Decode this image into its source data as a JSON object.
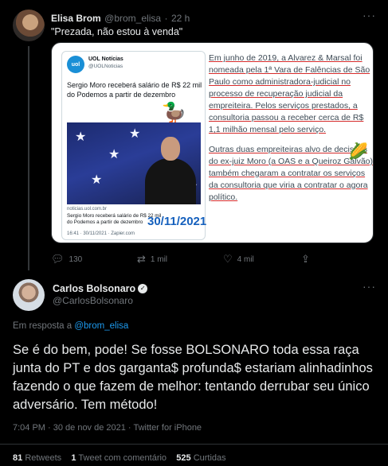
{
  "reply_parent": {
    "name": "Elisa Brom",
    "handle": "@brom_elisa",
    "separator": "·",
    "time": "22 h",
    "text": "\"Prezada, não estou à venda\"",
    "media": {
      "uol_logo_text": "uol",
      "uol_name": "UOL Notícias",
      "uol_handle": "@UOLNoticias",
      "headline": "Sergio Moro receberá salário de R$ 22 mil do Podemos a partir de dezembro",
      "source": "noticias.uol.com.br",
      "source_headline": "Sergio Moro receberá salário de R$ 22 mil do Podemos a partir de dezembro",
      "date_stamp": "30/11/2021",
      "card_time": "16:41 · 30/11/2021 · Zapier.com",
      "side_text_p1": "Em junho de 2019, a Alvarez & Marsal foi nomeada pela 1ª Vara de Falências de São Paulo como administradora-judicial no processo de recuperação judicial da empreiteira. Pelos serviços prestados, a consultoria passou a receber cerca de R$ 1,1 milhão mensal pelo serviço.",
      "side_text_p2": "Outras duas empreiteiras alvo de decisões do ex-juiz Moro (a OAS e a Queiroz Galvão) também chegaram a contratar os serviços da consultoria que viria a contratar o agora político."
    },
    "actions": {
      "replies": "130",
      "retweets": "1 mil",
      "likes": "4 mil"
    }
  },
  "main_tweet": {
    "name": "Carlos Bolsonaro",
    "handle": "@CarlosBolsonaro",
    "replying_prefix": "Em resposta a",
    "replying_to": "@brom_elisa",
    "text": "Se é do bem, pode! Se fosse BOLSONARO toda essa raça junta do PT e dos garganta$ profunda$ estariam alinhadinhos fazendo o que fazem de melhor: tentando derrubar seu único adversário. Tem método!",
    "timestamp": "7:04 PM · 30 de nov de 2021 · Twitter for iPhone",
    "stats": {
      "retweets_count": "81",
      "retweets_label": "Retweets",
      "quotes_count": "1",
      "quotes_label": "Tweet com comentário",
      "likes_count": "525",
      "likes_label": "Curtidas"
    }
  },
  "colors": {
    "background": "#000000",
    "accent": "#1d9bf0",
    "muted": "#71767b"
  }
}
